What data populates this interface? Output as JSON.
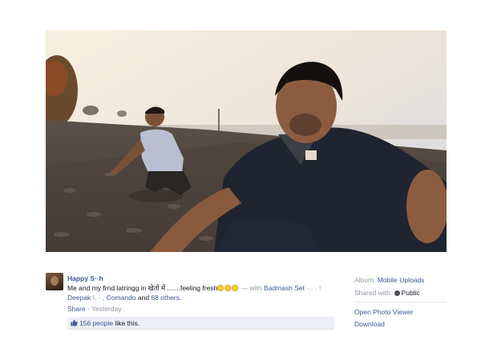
{
  "post": {
    "author": "Happy S··h",
    "text_before": "Me and my frnd latringg in खेतों में .......feeling fresh",
    "text_with": " — with ",
    "tag_1": "Badmash Set",
    "tag_1_rest": " ·.· · !",
    "line2_name": "Deepak ",
    "line2_mid": " I, · , ",
    "tag_2": "Comando",
    "tag_and": " and ",
    "others": "68 others",
    "others_end": "."
  },
  "meta": {
    "share": "Share",
    "separator": " · ",
    "time": "Yesterday"
  },
  "likes": {
    "count_text": "156 people",
    "suffix": " like this."
  },
  "sidebar": {
    "album_label": "Album: ",
    "album_value": "Mobile Uploads",
    "shared_label": "Shared with: ",
    "shared_value": "Public",
    "open_viewer": "Open Photo Viewer",
    "download": "Download"
  },
  "icons": {
    "emoji": "smiley-emoji-icon",
    "thumb": "thumbs-up-icon",
    "globe": "globe-icon"
  },
  "colors": {
    "link": "#3b5998",
    "muted": "#9197a3",
    "likes_bg": "#eceff5"
  }
}
